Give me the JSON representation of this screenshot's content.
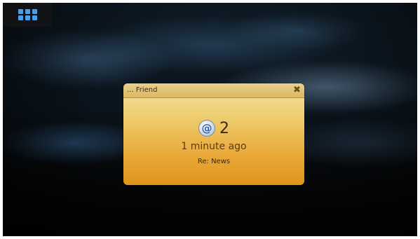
{
  "launcher": {
    "icon": "app-grid-icon",
    "color": "#4a9fe8"
  },
  "notification": {
    "title": "... Friend",
    "close_icon": "close-icon",
    "type_icon": "email-at-icon",
    "at_glyph": "@",
    "count": "2",
    "time_ago": "1 minute ago",
    "subject": "Re: News",
    "accent_top": "#f6e4a4",
    "accent_bottom": "#e0951a"
  }
}
